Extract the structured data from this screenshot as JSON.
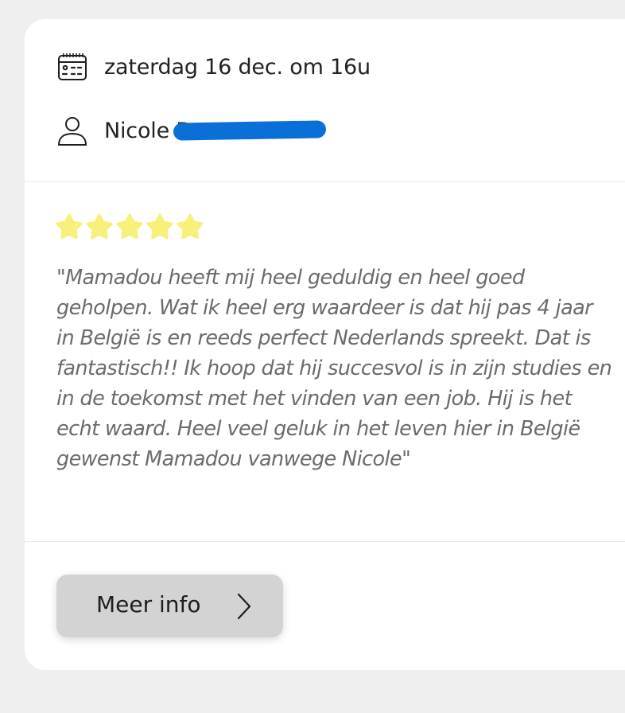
{
  "event": {
    "date_text": "zaterdag 16 dec. om 16u",
    "person_name": "Nicole D",
    "icons": {
      "date": "calendar-icon",
      "person": "user-icon"
    }
  },
  "review": {
    "rating": 5,
    "rating_max": 5,
    "star_color": "#f7f07a",
    "text": "\"Mamadou heeft mij heel geduldig en heel goed geholpen. Wat ik heel erg waardeer is dat hij pas 4 jaar in België is en reeds perfect Nederlands spreekt. Dat is fantastisch!! Ik hoop dat hij succesvol is in zijn studies en in de toekomst met het vinden van een job. Hij is het echt waard. Heel veel geluk in het leven hier in België gewenst Mamadou vanwege Nicole\""
  },
  "actions": {
    "more_info_label": "Meer info",
    "more_info_icon": "chevron-right-icon"
  },
  "colors": {
    "redaction": "#0a6fd6",
    "button_bg": "#d3d3d3",
    "review_text": "#6b6b6b"
  }
}
